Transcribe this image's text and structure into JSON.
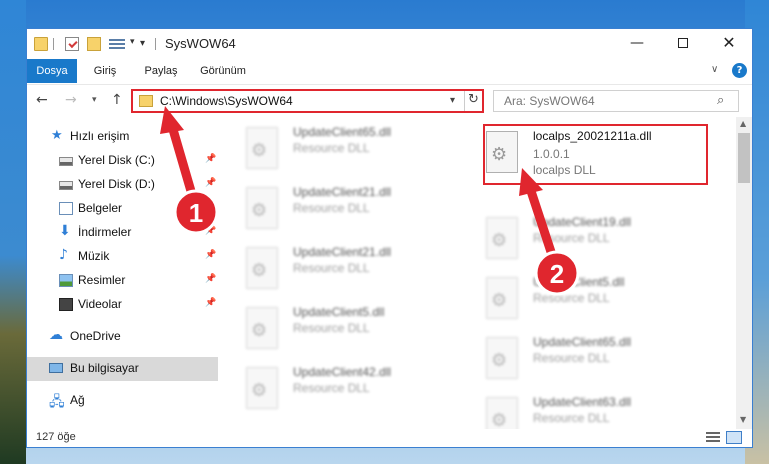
{
  "window": {
    "title": "SysWOW64",
    "controls": {
      "minimize": "—",
      "close": "✕"
    }
  },
  "ribbon": {
    "tabs": [
      "Dosya",
      "Giriş",
      "Paylaş",
      "Görünüm"
    ],
    "help": "?"
  },
  "address": {
    "path": "C:\\Windows\\SysWOW64",
    "search_placeholder": "Ara: SysWOW64"
  },
  "sidebar": {
    "items": [
      {
        "label": "Hızlı erişim",
        "icon": "star-icon"
      },
      {
        "label": "Yerel Disk (C:)",
        "icon": "drive-icon",
        "pinned": true
      },
      {
        "label": "Yerel Disk (D:)",
        "icon": "drive-icon",
        "pinned": true
      },
      {
        "label": "Belgeler",
        "icon": "documents-icon",
        "pinned": true
      },
      {
        "label": "İndirmeler",
        "icon": "downloads-icon",
        "pinned": true
      },
      {
        "label": "Müzik",
        "icon": "music-icon",
        "pinned": true
      },
      {
        "label": "Resimler",
        "icon": "pictures-icon",
        "pinned": true
      },
      {
        "label": "Videolar",
        "icon": "videos-icon",
        "pinned": true
      },
      {
        "label": "OneDrive",
        "icon": "onedrive-icon"
      },
      {
        "label": "Bu bilgisayar",
        "icon": "computer-icon",
        "selected": true
      },
      {
        "label": "Ağ",
        "icon": "network-icon"
      }
    ]
  },
  "files": {
    "left": [
      {
        "name": "UpdateClient65.dll",
        "type": "Resource DLL"
      },
      {
        "name": "UpdateClient21.dll",
        "type": "Resource DLL"
      },
      {
        "name": "UpdateClient21.dll",
        "type": "Resource DLL"
      },
      {
        "name": "UpdateClient5.dll",
        "type": "Resource DLL"
      },
      {
        "name": "UpdateClient42.dll",
        "type": "Resource DLL"
      }
    ],
    "right": [
      {
        "name": "localps_20021211a.dll",
        "version": "1.0.0.1",
        "type": "localps DLL"
      },
      {
        "name": "UpdateClient19.dll",
        "type": "Resource DLL"
      },
      {
        "name": "UpdateClient5.dll",
        "type": "Resource DLL"
      },
      {
        "name": "UpdateClient65.dll",
        "type": "Resource DLL"
      },
      {
        "name": "UpdateClient63.dll",
        "type": "Resource DLL"
      }
    ]
  },
  "status": {
    "item_count": "127 öğe"
  },
  "annotations": {
    "step1": "1",
    "step2": "2",
    "color": "#e0262e"
  }
}
